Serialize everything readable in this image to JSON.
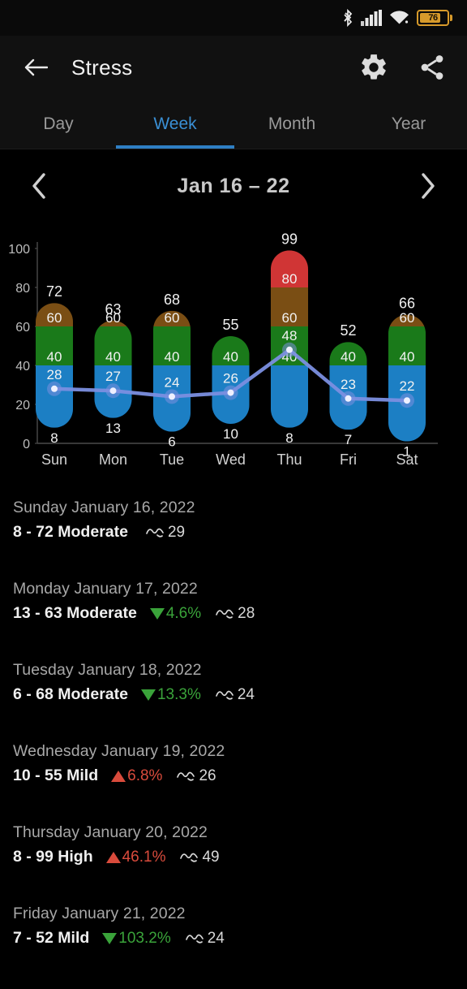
{
  "statusbar": {
    "bluetooth_icon": "bluetooth-icon",
    "signal_icon": "cellular-signal-icon",
    "wifi_icon": "wifi-icon",
    "battery_icon": "battery-icon",
    "battery_percent": "76"
  },
  "appbar": {
    "back_icon": "back-arrow-icon",
    "title": "Stress",
    "settings_icon": "gear-icon",
    "share_icon": "share-icon"
  },
  "tabs": [
    {
      "label": "Day",
      "active": false
    },
    {
      "label": "Week",
      "active": true
    },
    {
      "label": "Month",
      "active": false
    },
    {
      "label": "Year",
      "active": false
    }
  ],
  "weeknav": {
    "prev_icon": "chevron-left-icon",
    "title": "Jan 16 – 22",
    "next_icon": "chevron-right-icon"
  },
  "colors": {
    "blue": "#1c7fc4",
    "green": "#1a7a1a",
    "brown": "#7a4e14",
    "red": "#d03535",
    "line": "#7b8fe0",
    "accent": "#3a8fd4",
    "up": "#d94b3c",
    "down": "#3aa33a",
    "background": "#000000"
  },
  "chart_data": {
    "type": "bar",
    "title": "Jan 16 – 22",
    "xlabel": "",
    "ylabel": "",
    "ylim": [
      0,
      105
    ],
    "yticks": [
      0,
      20,
      40,
      60,
      80,
      100
    ],
    "grid": false,
    "legend": null,
    "categories": [
      "Sun",
      "Mon",
      "Tue",
      "Wed",
      "Thu",
      "Fri",
      "Sat"
    ],
    "bars": [
      {
        "day": "Sun",
        "min": 8,
        "max": 72,
        "top_label": "72",
        "segments": [
          {
            "band": "mild",
            "from": 8,
            "to": 40,
            "color": "#1c7fc4",
            "label": "8",
            "label_pos": "bottom"
          },
          {
            "band": "moderate",
            "from": 40,
            "to": 60,
            "color": "#1a7a1a",
            "label": "40",
            "label_pos": "top"
          },
          {
            "band": "high",
            "from": 60,
            "to": 72,
            "color": "#7a4e14",
            "label": "60",
            "label_pos": "top"
          }
        ],
        "line_value": 28
      },
      {
        "day": "Mon",
        "min": 13,
        "max": 63,
        "top_label": "63",
        "segments": [
          {
            "band": "mild",
            "from": 13,
            "to": 40,
            "color": "#1c7fc4",
            "label": "13",
            "label_pos": "bottom"
          },
          {
            "band": "moderate",
            "from": 40,
            "to": 60,
            "color": "#1a7a1a",
            "label": "40",
            "label_pos": "top"
          },
          {
            "band": "high",
            "from": 60,
            "to": 63,
            "color": "#7a4e14",
            "label": "60",
            "label_pos": "top"
          }
        ],
        "line_value": 27
      },
      {
        "day": "Tue",
        "min": 6,
        "max": 68,
        "top_label": "68",
        "segments": [
          {
            "band": "mild",
            "from": 6,
            "to": 40,
            "color": "#1c7fc4",
            "label": "6",
            "label_pos": "bottom"
          },
          {
            "band": "moderate",
            "from": 40,
            "to": 60,
            "color": "#1a7a1a",
            "label": "40",
            "label_pos": "top"
          },
          {
            "band": "high",
            "from": 60,
            "to": 68,
            "color": "#7a4e14",
            "label": "60",
            "label_pos": "top"
          }
        ],
        "line_value": 24
      },
      {
        "day": "Wed",
        "min": 10,
        "max": 55,
        "top_label": "55",
        "segments": [
          {
            "band": "mild",
            "from": 10,
            "to": 40,
            "color": "#1c7fc4",
            "label": "10",
            "label_pos": "bottom"
          },
          {
            "band": "moderate",
            "from": 40,
            "to": 55,
            "color": "#1a7a1a",
            "label": "40",
            "label_pos": "top"
          }
        ],
        "line_value": 26
      },
      {
        "day": "Thu",
        "min": 8,
        "max": 99,
        "top_label": "99",
        "segments": [
          {
            "band": "mild",
            "from": 8,
            "to": 40,
            "color": "#1c7fc4",
            "label": "8",
            "label_pos": "bottom"
          },
          {
            "band": "moderate",
            "from": 40,
            "to": 60,
            "color": "#1a7a1a",
            "label": "40",
            "label_pos": "top"
          },
          {
            "band": "high",
            "from": 60,
            "to": 80,
            "color": "#7a4e14",
            "label": "60",
            "label_pos": "top"
          },
          {
            "band": "very_high",
            "from": 80,
            "to": 99,
            "color": "#d03535",
            "label": "80",
            "label_pos": "top"
          }
        ],
        "extra_label": "48",
        "line_value": 48
      },
      {
        "day": "Fri",
        "min": 7,
        "max": 52,
        "top_label": "52",
        "segments": [
          {
            "band": "mild",
            "from": 7,
            "to": 40,
            "color": "#1c7fc4",
            "label": "7",
            "label_pos": "bottom"
          },
          {
            "band": "moderate",
            "from": 40,
            "to": 52,
            "color": "#1a7a1a",
            "label": "40",
            "label_pos": "top"
          }
        ],
        "line_value": 23
      },
      {
        "day": "Sat",
        "min": 1,
        "max": 66,
        "top_label": "66",
        "segments": [
          {
            "band": "mild",
            "from": 1,
            "to": 40,
            "color": "#1c7fc4",
            "label": "1",
            "label_pos": "bottom"
          },
          {
            "band": "moderate",
            "from": 40,
            "to": 60,
            "color": "#1a7a1a",
            "label": "40",
            "label_pos": "top"
          },
          {
            "band": "high",
            "from": 60,
            "to": 66,
            "color": "#7a4e14",
            "label": "60",
            "label_pos": "top"
          }
        ],
        "line_value": 22
      }
    ],
    "series": [
      {
        "name": "average",
        "values": [
          28,
          27,
          24,
          26,
          48,
          23,
          22
        ],
        "color": "#7b8fe0"
      }
    ]
  },
  "list": [
    {
      "date": "Sunday January 16, 2022",
      "range": "8 - 72 Moderate",
      "delta": null,
      "delta_dir": null,
      "resp_icon": "respiration-icon",
      "resp": "29"
    },
    {
      "date": "Monday January 17, 2022",
      "range": "13 - 63 Moderate",
      "delta": "4.6%",
      "delta_dir": "down",
      "resp_icon": "respiration-icon",
      "resp": "28"
    },
    {
      "date": "Tuesday January 18, 2022",
      "range": "6 - 68 Moderate",
      "delta": "13.3%",
      "delta_dir": "down",
      "resp_icon": "respiration-icon",
      "resp": "24"
    },
    {
      "date": "Wednesday January 19, 2022",
      "range": "10 - 55 Mild",
      "delta": "6.8%",
      "delta_dir": "up",
      "resp_icon": "respiration-icon",
      "resp": "26"
    },
    {
      "date": "Thursday January 20, 2022",
      "range": "8 - 99 High",
      "delta": "46.1%",
      "delta_dir": "up",
      "resp_icon": "respiration-icon",
      "resp": "49"
    },
    {
      "date": "Friday January 21, 2022",
      "range": "7 - 52 Mild",
      "delta": "103.2%",
      "delta_dir": "down",
      "resp_icon": "respiration-icon",
      "resp": "24"
    }
  ]
}
